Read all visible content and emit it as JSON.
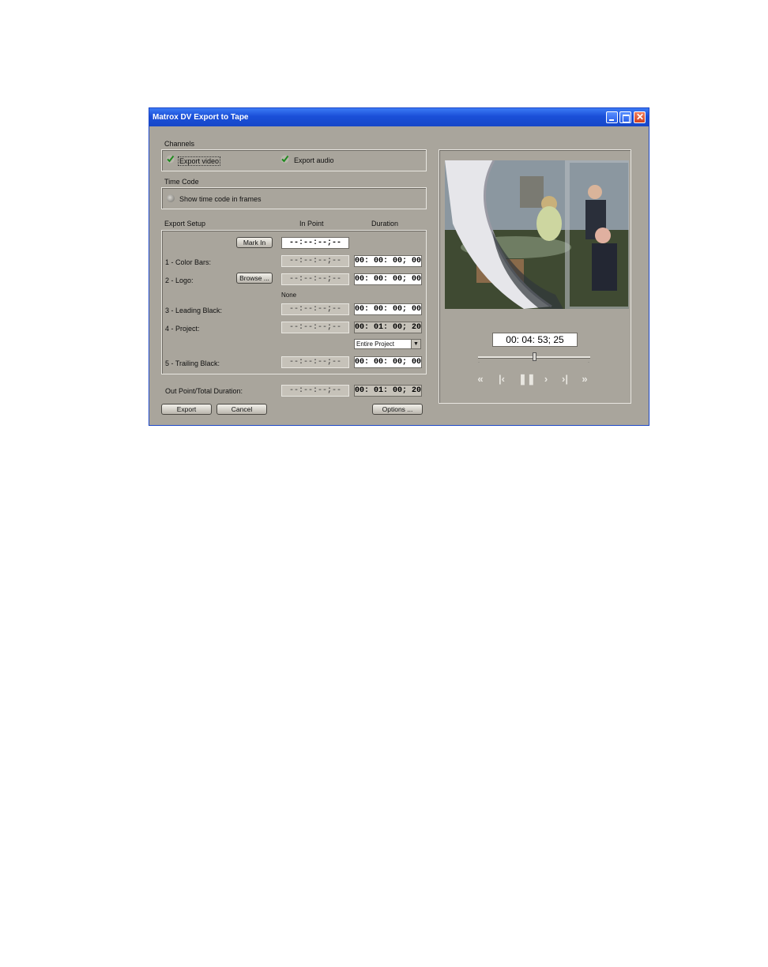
{
  "window": {
    "title": "Matrox DV Export to Tape"
  },
  "channels": {
    "label": "Channels",
    "export_video": "Export video",
    "export_audio": "Export audio",
    "export_video_checked": true,
    "export_audio_checked": true
  },
  "timecode": {
    "label": "Time Code",
    "show_frames": "Show time code in frames"
  },
  "export_setup": {
    "label": "Export Setup",
    "col_in": "In Point",
    "col_duration": "Duration",
    "mark_in_label": "Mark In",
    "mark_in_value": "--:--:--;--",
    "rows": [
      {
        "label": "1 - Color Bars:",
        "in": "--:--:--;--",
        "duration": "00: 00: 00; 00"
      },
      {
        "label": "2 - Logo:",
        "in": "--:--:--;--",
        "duration": "00: 00: 00; 00"
      },
      {
        "label": "3 - Leading Black:",
        "in": "--:--:--;--",
        "duration": "00: 00: 00; 00"
      },
      {
        "label": "4 - Project:",
        "in": "--:--:--;--",
        "duration": "00: 01: 00; 20"
      },
      {
        "label": "5 - Trailing Black:",
        "in": "--:--:--;--",
        "duration": "00: 00: 00; 00"
      }
    ],
    "browse_label": "Browse ...",
    "logo_file": "None",
    "project_select": "Entire Project"
  },
  "out_point": {
    "label": "Out Point/Total Duration:",
    "in": "--:--:--;--",
    "duration": "00: 01: 00; 20"
  },
  "buttons": {
    "export": "Export",
    "cancel": "Cancel",
    "options": "Options ..."
  },
  "preview": {
    "timecode": "00: 04: 53; 25",
    "slider_position": 0.5
  },
  "colors": {
    "window_bg": "#a9a59c",
    "titlebar": "#1a4fd8",
    "check": "#1f8a1f"
  }
}
